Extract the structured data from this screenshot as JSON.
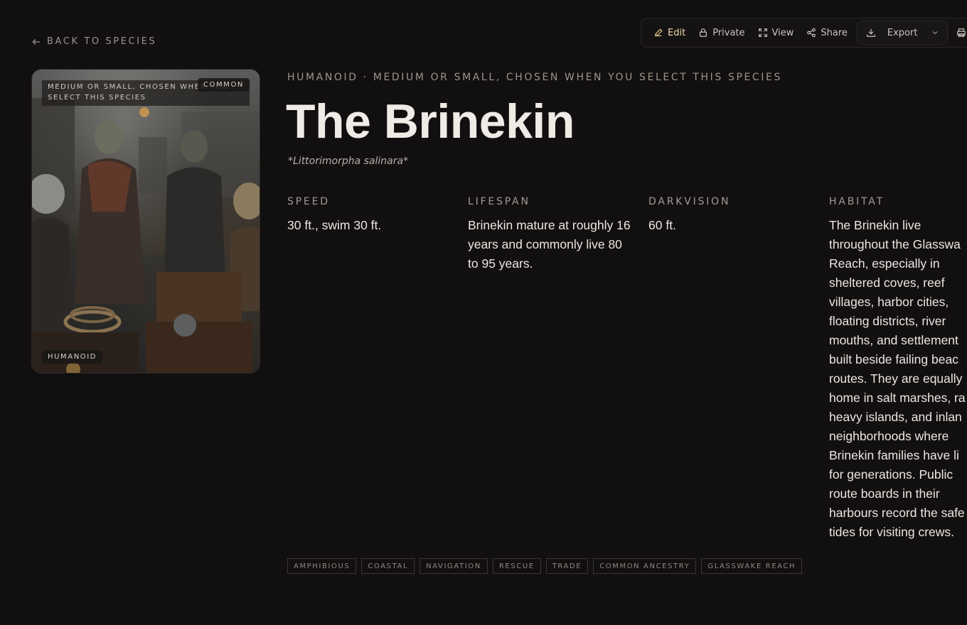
{
  "toolbar": {
    "edit": "Edit",
    "private": "Private",
    "view": "View",
    "share": "Share",
    "export": "Export"
  },
  "back_link": "BACK TO SPECIES",
  "card": {
    "size_text": "MEDIUM OR SMALL, CHOSEN WHEN YOU SELECT THIS SPECIES",
    "rarity": "COMMON",
    "type": "HUMANOID"
  },
  "species": {
    "kicker": "HUMANOID · MEDIUM OR SMALL, CHOSEN WHEN YOU SELECT THIS SPECIES",
    "name": "The Brinekin",
    "scientific": "*Littorimorpha salinara*"
  },
  "stats": [
    {
      "label": "SPEED",
      "value": "30 ft., swim 30 ft."
    },
    {
      "label": "LIFESPAN",
      "value": "Brinekin mature at roughly 16 years and commonly live 80 to 95 years."
    },
    {
      "label": "DARKVISION",
      "value": "60 ft."
    },
    {
      "label": "HABITAT",
      "value": "The Brinekin live throughout the Glasswa Reach, especially in sheltered coves, reef villages, harbor cities, floating districts, river mouths, and settlement built beside failing beac routes. They are equally home in salt marshes, ra heavy islands, and inlan neighborhoods where Brinekin families have li for generations. Public route boards in their harbours record the safe tides for visiting crews."
    }
  ],
  "tags": [
    "AMPHIBIOUS",
    "COASTAL",
    "NAVIGATION",
    "RESCUE",
    "TRADE",
    "COMMON ANCESTRY",
    "GLASSWAKE REACH"
  ]
}
